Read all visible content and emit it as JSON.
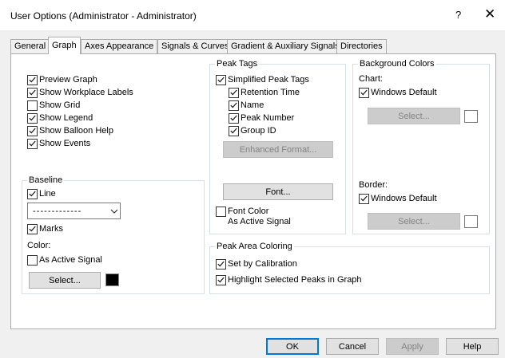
{
  "window": {
    "title": "User Options (Administrator - Administrator)",
    "help_glyph": "?",
    "close_glyph": "✕"
  },
  "tabs": [
    {
      "label": "General",
      "active": false
    },
    {
      "label": "Graph",
      "active": true
    },
    {
      "label": "Axes Appearance",
      "active": false
    },
    {
      "label": "Signals & Curves",
      "active": false
    },
    {
      "label": "Gradient & Auxiliary Signals",
      "active": false
    },
    {
      "label": "Directories",
      "active": false
    }
  ],
  "display_options": [
    {
      "label": "Preview Graph",
      "checked": true
    },
    {
      "label": "Show Workplace Labels",
      "checked": true
    },
    {
      "label": "Show Grid",
      "checked": false
    },
    {
      "label": "Show Legend",
      "checked": true
    },
    {
      "label": "Show Balloon Help",
      "checked": true
    },
    {
      "label": "Show Events",
      "checked": true
    }
  ],
  "baseline": {
    "title": "Baseline",
    "line": {
      "label": "Line",
      "checked": true
    },
    "line_style_value": "- - - - - - - - - - - - -",
    "marks": {
      "label": "Marks",
      "checked": true
    },
    "color_label": "Color:",
    "as_active_signal": {
      "label": "As Active Signal",
      "checked": false
    },
    "select_label": "Select...",
    "swatch_color": "#000000"
  },
  "peak_tags": {
    "title": "Peak Tags",
    "simplified": {
      "label": "Simplified Peak Tags",
      "checked": true
    },
    "items": [
      {
        "label": "Retention Time",
        "checked": true
      },
      {
        "label": "Name",
        "checked": true
      },
      {
        "label": "Peak Number",
        "checked": true
      },
      {
        "label": "Group ID",
        "checked": true
      }
    ],
    "enhanced_format_label": "Enhanced Format...",
    "font_label": "Font...",
    "font_color": {
      "label": "Font Color",
      "checked": false
    },
    "font_color_sub": "As Active Signal"
  },
  "background_colors": {
    "title": "Background Colors",
    "chart_label": "Chart:",
    "chart_windows_default": {
      "label": "Windows Default",
      "checked": true
    },
    "chart_select_label": "Select...",
    "border_label": "Border:",
    "border_windows_default": {
      "label": "Windows Default",
      "checked": true
    },
    "border_select_label": "Select..."
  },
  "peak_area": {
    "title": "Peak Area Coloring",
    "set_by_calibration": {
      "label": "Set by Calibration",
      "checked": true
    },
    "highlight_selected": {
      "label": "Highlight Selected Peaks in Graph",
      "checked": true
    }
  },
  "footer": {
    "ok": "OK",
    "cancel": "Cancel",
    "apply": "Apply",
    "help": "Help"
  }
}
